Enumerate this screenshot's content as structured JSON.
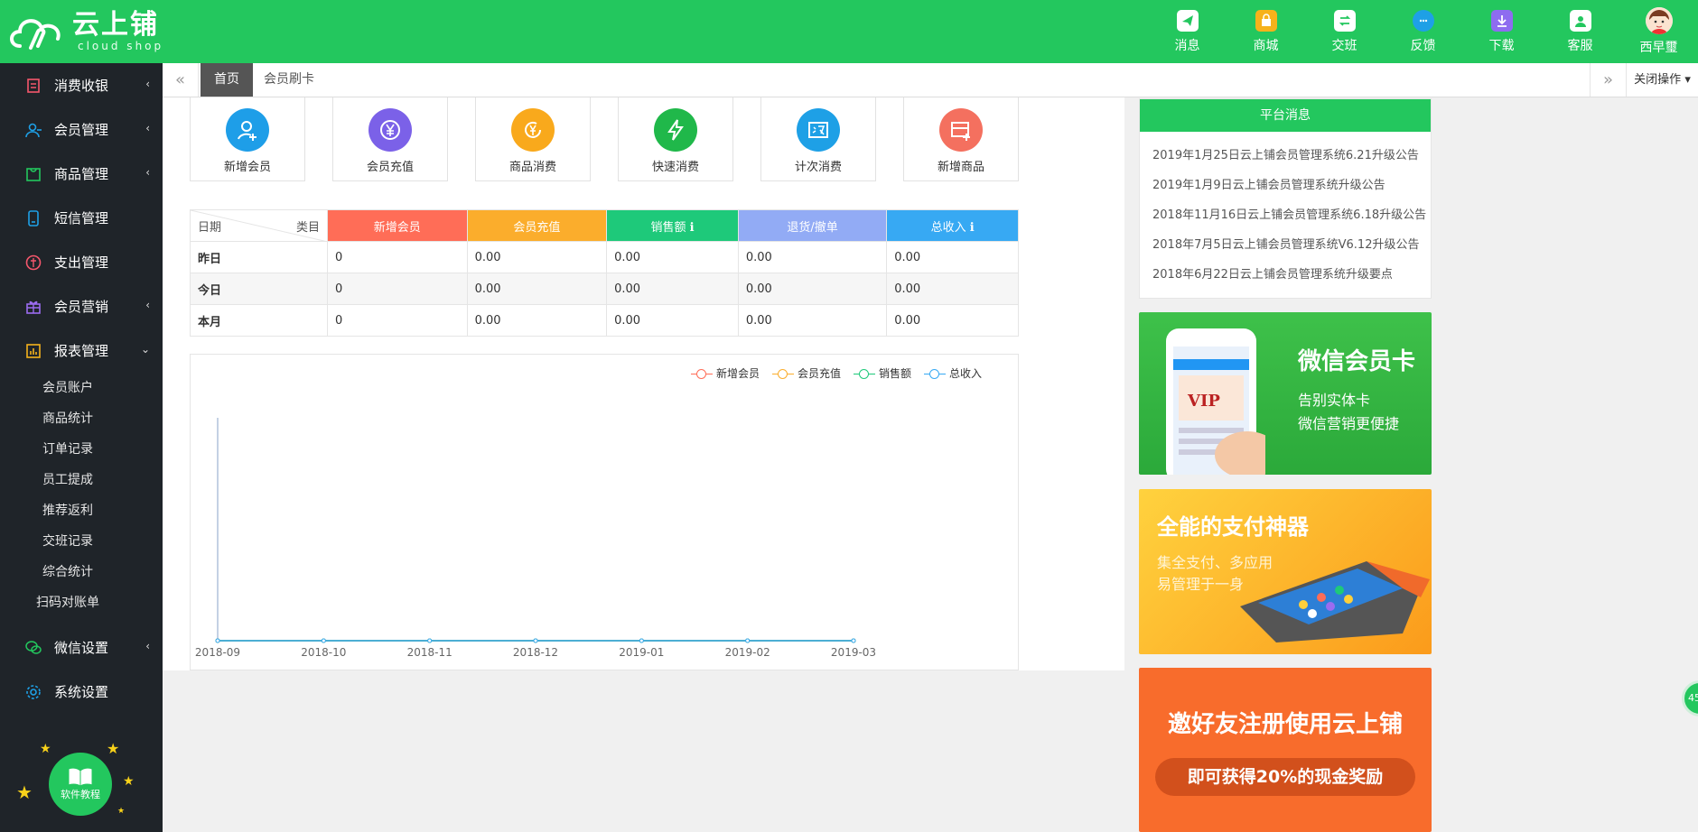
{
  "brand": {
    "name_cn": "云上铺",
    "name_en": "cloud shop"
  },
  "top_nav": [
    {
      "label": "消息",
      "icon": "message-icon"
    },
    {
      "label": "商城",
      "icon": "shop-icon"
    },
    {
      "label": "交班",
      "icon": "shift-icon"
    },
    {
      "label": "反馈",
      "icon": "feedback-icon"
    },
    {
      "label": "下载",
      "icon": "download-icon"
    },
    {
      "label": "客服",
      "icon": "service-icon"
    },
    {
      "label": "西早璽",
      "icon": "avatar"
    }
  ],
  "sidebar": {
    "items": [
      {
        "label": "消费收银",
        "icon": "cashier-icon"
      },
      {
        "label": "会员管理",
        "icon": "member-icon"
      },
      {
        "label": "商品管理",
        "icon": "goods-icon"
      },
      {
        "label": "短信管理",
        "icon": "sms-icon"
      },
      {
        "label": "支出管理",
        "icon": "expense-icon"
      },
      {
        "label": "会员营销",
        "icon": "gift-icon"
      },
      {
        "label": "报表管理",
        "icon": "report-icon"
      }
    ],
    "sub_items": [
      "会员账户",
      "商品统计",
      "订单记录",
      "员工提成",
      "推荐返利",
      "交班记录",
      "综合统计",
      "扫码对账单"
    ],
    "bottom_items": [
      {
        "label": "微信设置",
        "icon": "wechat-icon"
      },
      {
        "label": "系统设置",
        "icon": "settings-icon"
      }
    ],
    "tutorial_label": "软件教程"
  },
  "tabs": {
    "home": "首页",
    "member_card": "会员刷卡",
    "close_ops": "关闭操作"
  },
  "quick_actions": [
    {
      "label": "新增会员",
      "color": "#1e9ee8"
    },
    {
      "label": "会员充值",
      "color": "#7b61e8"
    },
    {
      "label": "商品消费",
      "color": "#f9a91c"
    },
    {
      "label": "快速消费",
      "color": "#20b84a"
    },
    {
      "label": "计次消费",
      "color": "#1ea0e6"
    },
    {
      "label": "新增商品",
      "color": "#f4705f"
    }
  ],
  "stats_table": {
    "corner_left": "日期",
    "corner_right": "类目",
    "headers": [
      {
        "label": "新增会员",
        "color": "#ff6d57"
      },
      {
        "label": "会员充值",
        "color": "#fbad2c"
      },
      {
        "label": "销售额 ℹ",
        "color": "#1ec97a"
      },
      {
        "label": "退货/撤单",
        "color": "#92abf5"
      },
      {
        "label": "总收入 ℹ",
        "color": "#37a9f3"
      }
    ],
    "rows": [
      {
        "label": "昨日",
        "values": [
          "0",
          "0.00",
          "0.00",
          "0.00",
          "0.00"
        ]
      },
      {
        "label": "今日",
        "values": [
          "0",
          "0.00",
          "0.00",
          "0.00",
          "0.00"
        ]
      },
      {
        "label": "本月",
        "values": [
          "0",
          "0.00",
          "0.00",
          "0.00",
          "0.00"
        ]
      }
    ]
  },
  "chart_data": {
    "type": "line",
    "title": "",
    "xlabel": "",
    "ylabel": "",
    "categories": [
      "2018-09",
      "2018-10",
      "2018-11",
      "2018-12",
      "2019-01",
      "2019-02",
      "2019-03"
    ],
    "series": [
      {
        "name": "新增会员",
        "values": [
          0,
          0,
          0,
          0,
          0,
          0,
          0
        ],
        "color": "#ff6d57"
      },
      {
        "name": "会员充值",
        "values": [
          0,
          0,
          0,
          0,
          0,
          0,
          0
        ],
        "color": "#fbad2c"
      },
      {
        "name": "销售额",
        "values": [
          0,
          0,
          0,
          0,
          0,
          0,
          0
        ],
        "color": "#1ec97a"
      },
      {
        "name": "总收入",
        "values": [
          0,
          0,
          0,
          0,
          0,
          0,
          0
        ],
        "color": "#37a9f3"
      }
    ],
    "legend": "top-right",
    "grid": false
  },
  "notice": {
    "title": "平台消息",
    "items": [
      "2019年1月25日云上铺会员管理系统6.21升级公告",
      "2019年1月9日云上铺会员管理系统升级公告",
      "2018年11月16日云上铺会员管理系统6.18升级公告",
      "2018年7月5日云上铺会员管理系统V6.12升级公告",
      "2018年6月22日云上铺会员管理系统升级要点"
    ]
  },
  "banners": {
    "wechat": {
      "title": "微信会员卡",
      "line1": "告别实体卡",
      "line2": "微信营销更便捷"
    },
    "pay": {
      "title": "全能的支付神器",
      "line1": "集全支付、多应用",
      "line2": "易管理于一身"
    },
    "invite": {
      "title": "邀好友注册使用云上铺",
      "sub": "即可获得20%的现金奖励"
    }
  },
  "float_badge": "45"
}
